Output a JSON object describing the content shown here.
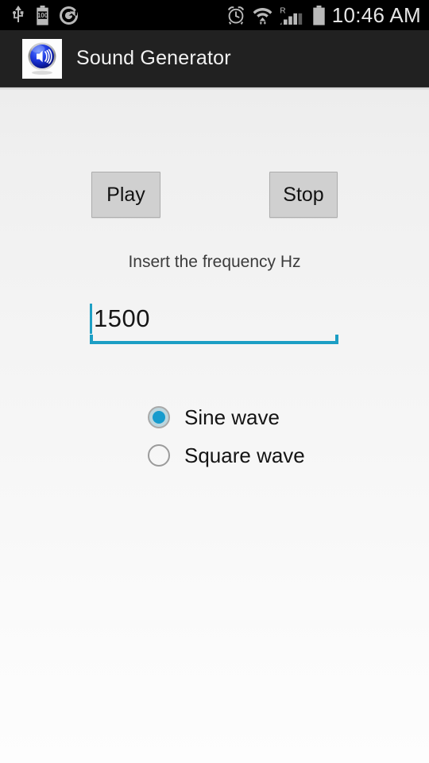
{
  "statusbar": {
    "time": "10:46 AM",
    "left_icons": [
      {
        "name": "usb-icon",
        "label": "USB"
      },
      {
        "name": "battery-100-icon",
        "label": "100"
      },
      {
        "name": "sync-circle-icon",
        "label": "Sync"
      }
    ],
    "right_icons": [
      {
        "name": "alarm-clock-icon",
        "label": "Alarm"
      },
      {
        "name": "wifi-icon",
        "label": "Wi-Fi"
      },
      {
        "name": "roaming-signal-icon",
        "label": "R"
      },
      {
        "name": "battery-icon",
        "label": "Battery"
      }
    ],
    "battery_text": "100",
    "roaming_text": "R"
  },
  "actionbar": {
    "title": "Sound Generator",
    "icon": "speaker-sphere-icon"
  },
  "main": {
    "play_label": "Play",
    "stop_label": "Stop",
    "frequency_label": "Insert the frequency Hz",
    "frequency_value": "1500",
    "frequency_placeholder": "",
    "waveforms": [
      {
        "label": "Sine wave",
        "selected": true
      },
      {
        "label": "Square wave",
        "selected": false
      }
    ]
  },
  "colors": {
    "accent": "#1c9ec4",
    "radio_fill": "#169bcd",
    "statusbar_bg": "#000000",
    "actionbar_bg": "#212121",
    "button_bg": "#d0d0d0"
  }
}
